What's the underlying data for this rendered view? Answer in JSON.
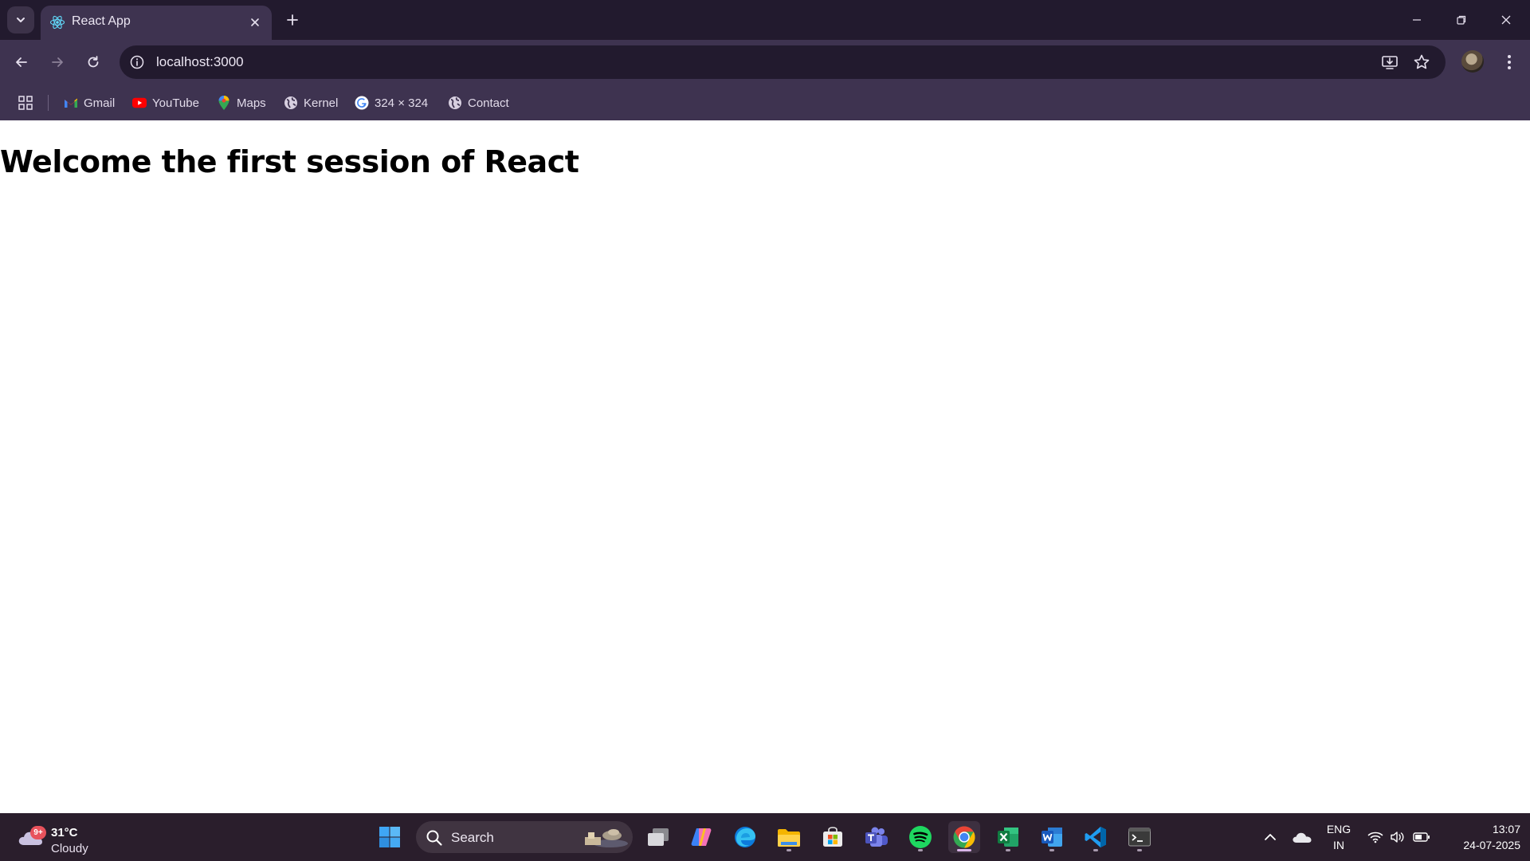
{
  "browser": {
    "tab": {
      "title": "React App"
    },
    "address": {
      "url": "localhost:3000"
    },
    "bookmarks": [
      {
        "label": "Gmail",
        "icon": "gmail-icon"
      },
      {
        "label": "YouTube",
        "icon": "youtube-icon"
      },
      {
        "label": "Maps",
        "icon": "maps-icon"
      },
      {
        "label": "Kernel",
        "icon": "globe-icon"
      },
      {
        "label": "324 × 324",
        "icon": "google-icon"
      },
      {
        "label": "Contact",
        "icon": "globe-icon"
      }
    ]
  },
  "page": {
    "heading": "Welcome the first session of React"
  },
  "taskbar": {
    "weather": {
      "temperature": "31°C",
      "condition": "Cloudy",
      "badge": "9+"
    },
    "search": {
      "label": "Search"
    },
    "pinned": [
      "windows-start-icon",
      "task-view-icon",
      "copilot-icon",
      "edge-icon",
      "file-explorer-icon",
      "microsoft-store-icon",
      "teams-icon",
      "spotify-icon",
      "chrome-icon",
      "excel-icon",
      "word-icon",
      "vscode-icon",
      "terminal-icon"
    ],
    "language": {
      "line1": "ENG",
      "line2": "IN"
    },
    "clock": {
      "time": "13:07",
      "date": "24-07-2025"
    }
  },
  "colors": {
    "tabbar_bg": "#221a2e",
    "toolbar_bg": "#3e3350",
    "taskbar_bg": "#2a1e2c"
  }
}
